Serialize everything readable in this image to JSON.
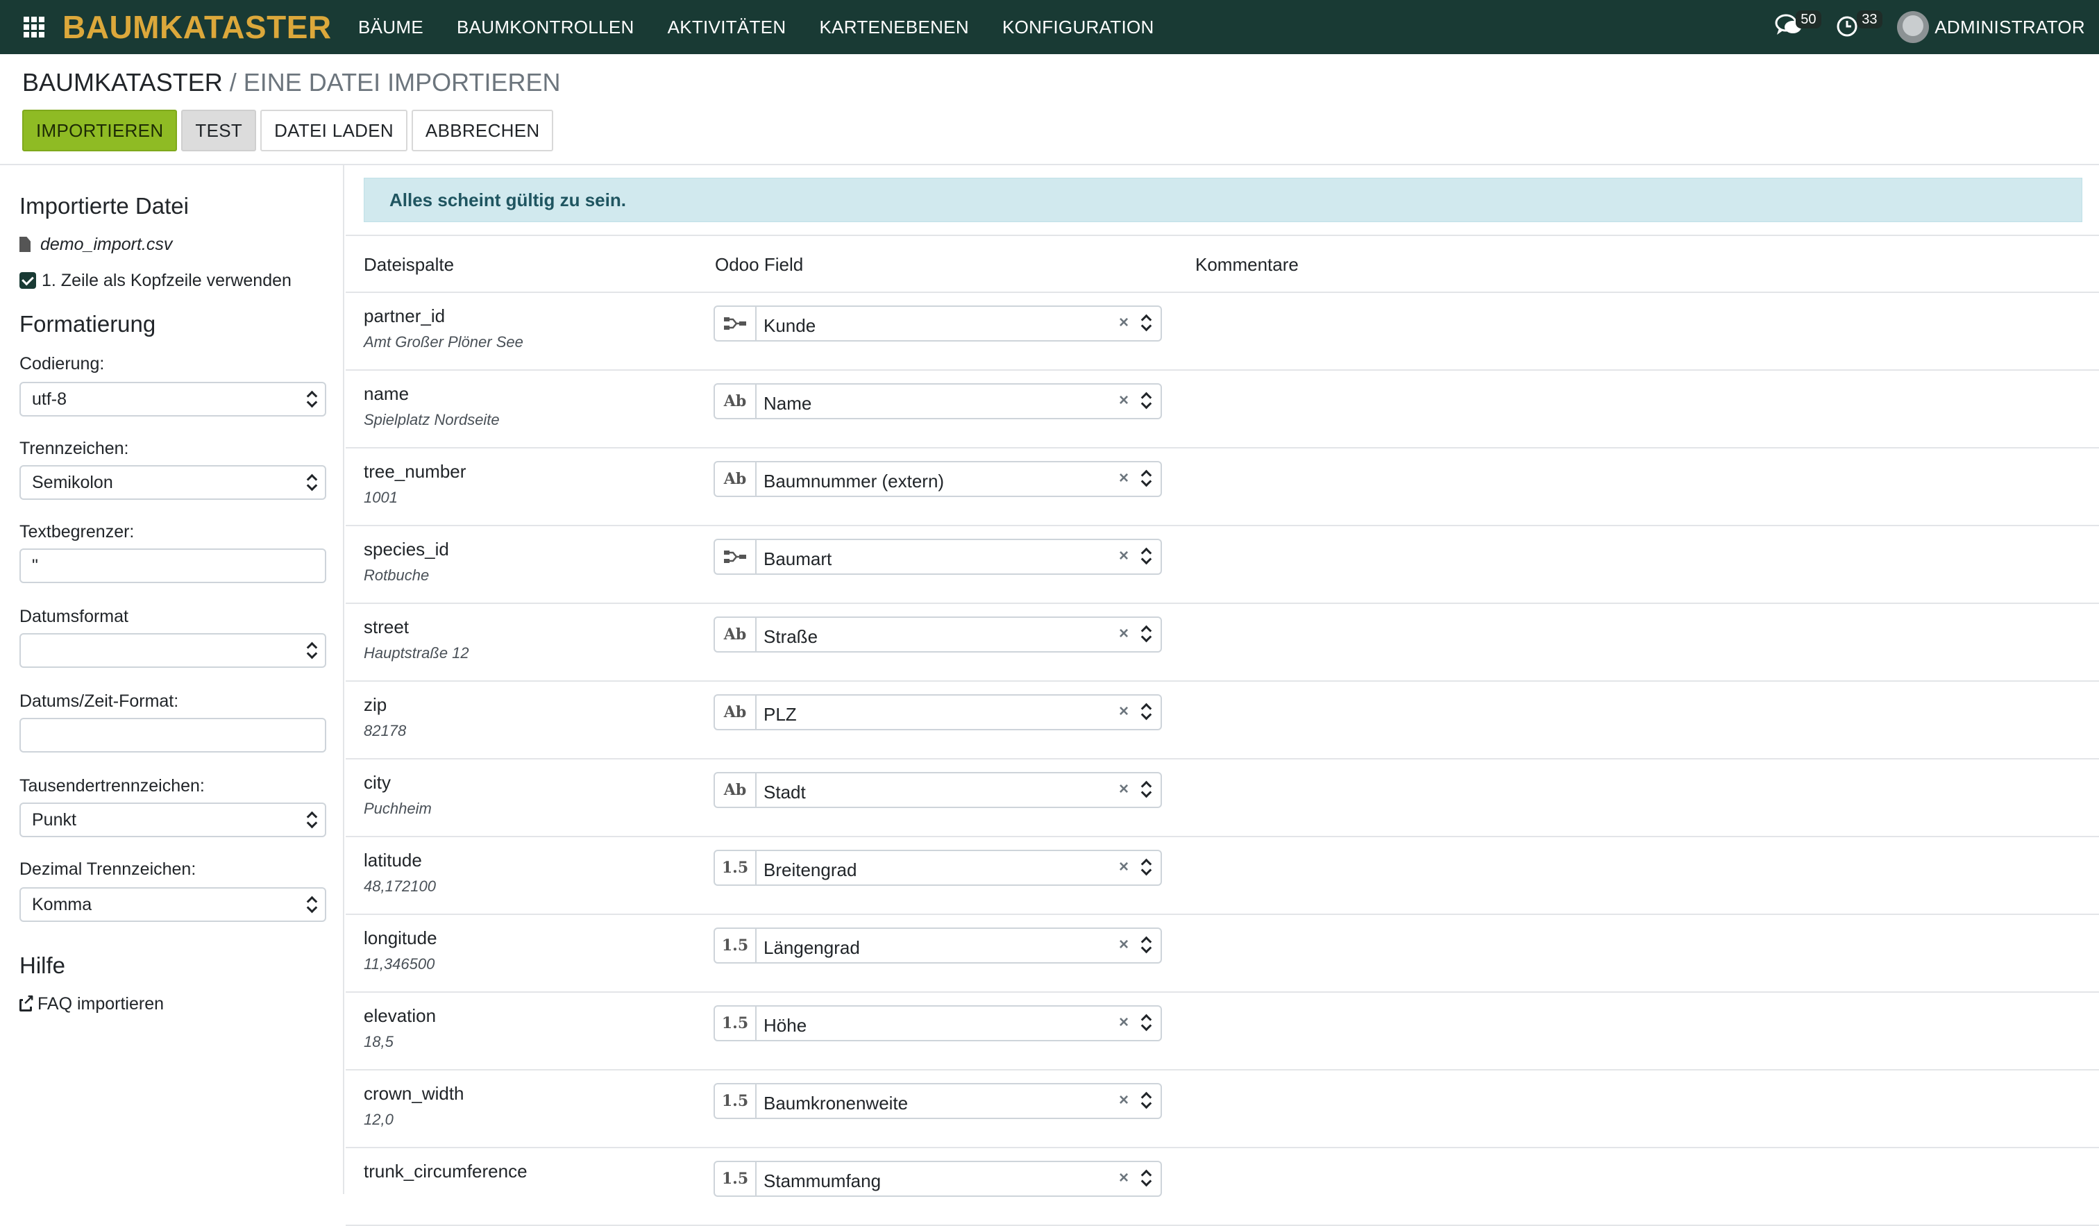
{
  "navbar": {
    "brand": "BAUMKATASTER",
    "menu": [
      "BÄUME",
      "BAUMKONTROLLEN",
      "AKTIVITÄTEN",
      "KARTENEBENEN",
      "KONFIGURATION"
    ],
    "messages_count": "50",
    "activities_count": "33",
    "user": "ADMINISTRATOR"
  },
  "breadcrumb": {
    "parent": "BAUMKATASTER",
    "separator": "/",
    "current": "EINE DATEI IMPORTIEREN"
  },
  "buttons": {
    "import": "IMPORTIEREN",
    "test": "TEST",
    "load": "DATEI LADEN",
    "cancel": "ABBRECHEN"
  },
  "sidebar": {
    "imported_title": "Importierte Datei",
    "filename": "demo_import.csv",
    "header_option": "1. Zeile als Kopfzeile verwenden",
    "format_title": "Formatierung",
    "encoding_label": "Codierung:",
    "encoding_value": "utf-8",
    "separator_label": "Trennzeichen:",
    "separator_value": "Semikolon",
    "quote_label": "Textbegrenzer:",
    "quote_value": "\"",
    "date_label": "Datumsformat",
    "date_value": "",
    "datetime_label": "Datums/Zeit-Format:",
    "datetime_value": "",
    "thousands_label": "Tausendertrennzeichen:",
    "thousands_value": "Punkt",
    "decimal_label": "Dezimal Trennzeichen:",
    "decimal_value": "Komma",
    "help_title": "Hilfe",
    "faq_link": "FAQ importieren"
  },
  "alert": "Alles scheint gültig zu sein.",
  "table": {
    "headers": {
      "column": "Dateispalte",
      "field": "Odoo Field",
      "comments": "Kommentare"
    },
    "rows": [
      {
        "name": "partner_id",
        "sample": "Amt Großer Plöner See",
        "type": "relation",
        "field": "Kunde"
      },
      {
        "name": "name",
        "sample": "Spielplatz Nordseite",
        "type": "Ab",
        "field": "Name"
      },
      {
        "name": "tree_number",
        "sample": "1001",
        "type": "Ab",
        "field": "Baumnummer (extern)"
      },
      {
        "name": "species_id",
        "sample": "Rotbuche",
        "type": "relation",
        "field": "Baumart"
      },
      {
        "name": "street",
        "sample": "Hauptstraße 12",
        "type": "Ab",
        "field": "Straße"
      },
      {
        "name": "zip",
        "sample": "82178",
        "type": "Ab",
        "field": "PLZ"
      },
      {
        "name": "city",
        "sample": "Puchheim",
        "type": "Ab",
        "field": "Stadt"
      },
      {
        "name": "latitude",
        "sample": "48,172100",
        "type": "1.5",
        "field": "Breitengrad"
      },
      {
        "name": "longitude",
        "sample": "11,346500",
        "type": "1.5",
        "field": "Längengrad"
      },
      {
        "name": "elevation",
        "sample": "18,5",
        "type": "1.5",
        "field": "Höhe"
      },
      {
        "name": "crown_width",
        "sample": "12,0",
        "type": "1.5",
        "field": "Baumkronenweite"
      },
      {
        "name": "trunk_circumference",
        "sample": "",
        "type": "1.5",
        "field": "Stammumfang"
      }
    ]
  },
  "colors": {
    "navbar": "#193a34",
    "brand": "#dca83b",
    "primary": "#8fbb24",
    "alert_bg": "#d1e9ee"
  }
}
